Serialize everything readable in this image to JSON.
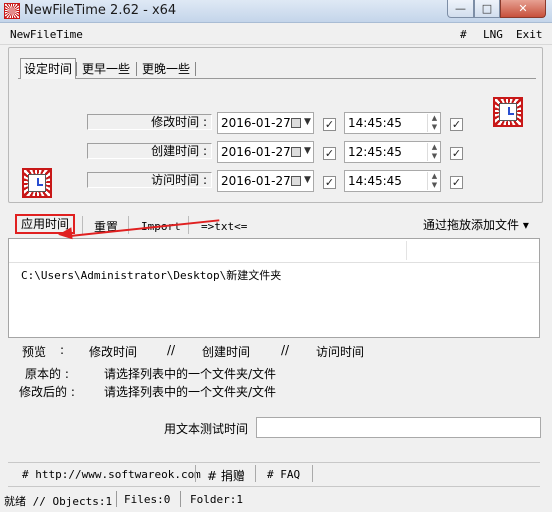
{
  "window": {
    "title": "NewFileTime 2.62 - x64"
  },
  "menubar": {
    "app_name": "NewFileTime",
    "hash": "#",
    "lng": "LNG",
    "exit": "Exit"
  },
  "tabs": [
    {
      "label": "设定时间"
    },
    {
      "label": "更早一些"
    },
    {
      "label": "更晚一些"
    }
  ],
  "rows": [
    {
      "label": "修改时间 :",
      "date": "2016-01-27",
      "time": "14:45:45",
      "date_checked": true,
      "time_checked": true
    },
    {
      "label": "创建时间 :",
      "date": "2016-01-27",
      "time": "12:45:45",
      "date_checked": true,
      "time_checked": true
    },
    {
      "label": "访问时间 :",
      "date": "2016-01-27",
      "time": "14:45:45",
      "date_checked": true,
      "time_checked": true
    }
  ],
  "toolbar": {
    "apply": "应用时间",
    "reset": "重置",
    "import": "Import",
    "txt": "=>txt<=",
    "drag_add": "通过拖放添加文件 ▾"
  },
  "file_list": {
    "items": [
      "C:\\Users\\Administrator\\Desktop\\新建文件夹"
    ]
  },
  "preview": {
    "label": "预览",
    "colon": ":",
    "modified": "修改时间",
    "sep1": "//",
    "created": "创建时间",
    "sep2": "//",
    "accessed": "访问时间",
    "original_label": "原本的 :",
    "original_value": "请选择列表中的一个文件夹/文件",
    "modified_label": "修改后的 :",
    "modified_value": "请选择列表中的一个文件夹/文件"
  },
  "text_test": {
    "label": "用文本测试时间",
    "value": ""
  },
  "links": {
    "website": "# http://www.softwareok.com",
    "donate": "# 捐赠",
    "faq": "# FAQ"
  },
  "status": {
    "state": "就绪 // Objects:1",
    "files": "Files:0",
    "folder": "Folder:1"
  },
  "colors": {
    "annotation": "#e02020",
    "clock_red": "#c81818"
  }
}
